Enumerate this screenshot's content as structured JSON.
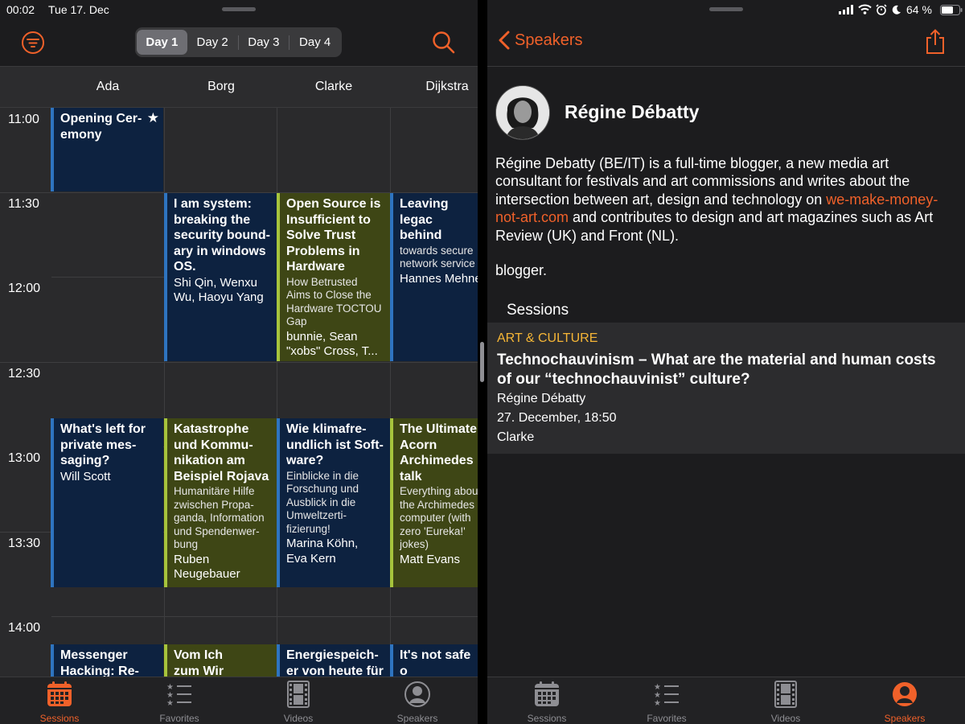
{
  "left": {
    "status": {
      "time": "00:02",
      "date": "Tue 17. Dec"
    },
    "days": [
      "Day 1",
      "Day 2",
      "Day 3",
      "Day 4"
    ],
    "rooms": [
      "Ada",
      "Borg",
      "Clarke",
      "Dijkstra"
    ],
    "times": [
      "11:00",
      "11:30",
      "12:00",
      "12:30",
      "13:00",
      "13:30",
      "14:00"
    ],
    "events": {
      "e1": {
        "title": "Opening Cer-\nemony",
        "favorite": true
      },
      "e2": {
        "title": "I am system:\nbreaking the\nsecurity bound-\nary in windows\nOS.",
        "speakers": "Shi Qin, Wenxu\nWu, Haoyu Yang"
      },
      "e3": {
        "title": "Open Source is\nInsufficient to\nSolve Trust\nProblems in\nHardware",
        "subtitle": "How Betrusted\nAims to Close the\nHardware TOCTOU\nGap",
        "speakers": "bunnie, Sean\n\"xobs\" Cross, T..."
      },
      "e4": {
        "title": "Leaving legac\nbehind",
        "subtitle": "towards secure\nnetwork service",
        "speakers": "Hannes Mehne"
      },
      "e5": {
        "title": "What's left for\nprivate mes-\nsaging?",
        "speakers": "Will Scott"
      },
      "e6": {
        "title": "Katastrophe\nund Kommu-\nnikation am\nBeispiel Rojava",
        "subtitle": "Humanitäre Hilfe\nzwischen Propa-\nganda, Information\nund Spendenwer-\nbung",
        "speakers": "Ruben\nNeugebauer"
      },
      "e7": {
        "title": "Wie klimafre-\nundlich ist Soft-\nware?",
        "subtitle": "Einblicke in die\nForschung und\nAusblick in die\nUmweltzerti-\nfizierung!",
        "speakers": "Marina Köhn,\nEva Kern"
      },
      "e8": {
        "title": "The Ultimate\nAcorn\nArchimedes\ntalk",
        "subtitle": "Everything abou\nthe Archimedes\ncomputer (with\nzero 'Eureka!'\njokes)",
        "speakers": "Matt Evans"
      },
      "e9": {
        "title": "Messenger\nHacking: Re-"
      },
      "e10": {
        "title": "Vom Ich\nzum Wir"
      },
      "e11": {
        "title": "Energiespeich-\ner von heute für"
      },
      "e12": {
        "title": "It's not safe o\nthe streets..."
      }
    },
    "tabs": [
      "Sessions",
      "Favorites",
      "Videos",
      "Speakers"
    ]
  },
  "right": {
    "status": {
      "battery": "64 %"
    },
    "back_label": "Speakers",
    "speaker_name": "Régine Débatty",
    "bio_before": "Régine Debatty (BE/IT) is a full-time blogger, a new media art consultant for festivals and art commissions and writes about the intersection between art, design and technology on ",
    "bio_link": "we-make-money-not-art.com",
    "bio_after": " and contributes to design and art magazines such as Art Review (UK) and Front (NL).",
    "bio_short": "blogger.",
    "sessions_heading": "Sessions",
    "session": {
      "category": "ART & CULTURE",
      "title": "Technochauvinism – What are the material and human costs of our “technochauvinist” culture?",
      "speaker": "Régine Débatty",
      "datetime": "27. December, 18:50",
      "room": "Clarke"
    },
    "tabs": [
      "Sessions",
      "Favorites",
      "Videos",
      "Speakers"
    ]
  },
  "colors": {
    "accent": "#f0612a",
    "category": "#f6b636",
    "event_blue": "#0d2240",
    "event_green": "#3e4615"
  }
}
